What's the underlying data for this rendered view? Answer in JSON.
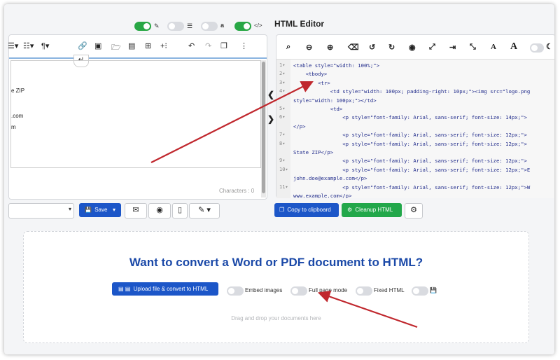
{
  "right_panel": {
    "title": "HTML Editor",
    "code_lines": [
      {
        "num": "1",
        "text": "<table style=\"width: 100%;\">"
      },
      {
        "num": "2",
        "text": "    <tbody>"
      },
      {
        "num": "3",
        "text": "        <tr>"
      },
      {
        "num": "4",
        "text": "            <td style=\"width: 100px; padding-right: 10px;\"><img src=\"logo.png"
      },
      {
        "num": "",
        "text": "style=\"width: 100px;\"></td>"
      },
      {
        "num": "5",
        "text": "            <td>"
      },
      {
        "num": "6",
        "text": "                <p style=\"font-family: Arial, sans-serif; font-size: 14px;\">"
      },
      {
        "num": "",
        "text": "</p>"
      },
      {
        "num": "7",
        "text": "                <p style=\"font-family: Arial, sans-serif; font-size: 12px;\">"
      },
      {
        "num": "8",
        "text": "                <p style=\"font-family: Arial, sans-serif; font-size: 12px;\">"
      },
      {
        "num": "",
        "text": "State ZIP</p>"
      },
      {
        "num": "9",
        "text": "                <p style=\"font-family: Arial, sans-serif; font-size: 12px;\">"
      },
      {
        "num": "10",
        "text": "                <p style=\"font-family: Arial, sans-serif; font-size: 12px;\">E"
      },
      {
        "num": "",
        "text": "john.doe@example.com</p>"
      },
      {
        "num": "11",
        "text": "                <p style=\"font-family: Arial, sans-serif; font-size: 12px;\">W"
      },
      {
        "num": "",
        "text": "www.example.com</p>"
      }
    ],
    "copy_label": "Copy to clipboard",
    "cleanup_label": "Cleanup HTML"
  },
  "left_panel": {
    "content_lines": [
      "e ZIP",
      ".com",
      "m"
    ],
    "characters_label": "Characters : 0",
    "save_label": "Save"
  },
  "convert_panel": {
    "heading": "Want to convert a Word or PDF document to HTML?",
    "upload_label": "Upload file & convert to HTML",
    "options": [
      "Embed images",
      "Full page mode",
      "Fixed HTML"
    ],
    "drag_text": "Drag and drop your documents here"
  },
  "colors": {
    "accent": "#1c56c8",
    "success": "#22a74a",
    "toggle_on": "#28a745",
    "heading": "#1b49a8",
    "annotation_arrow": "#c0272d"
  }
}
